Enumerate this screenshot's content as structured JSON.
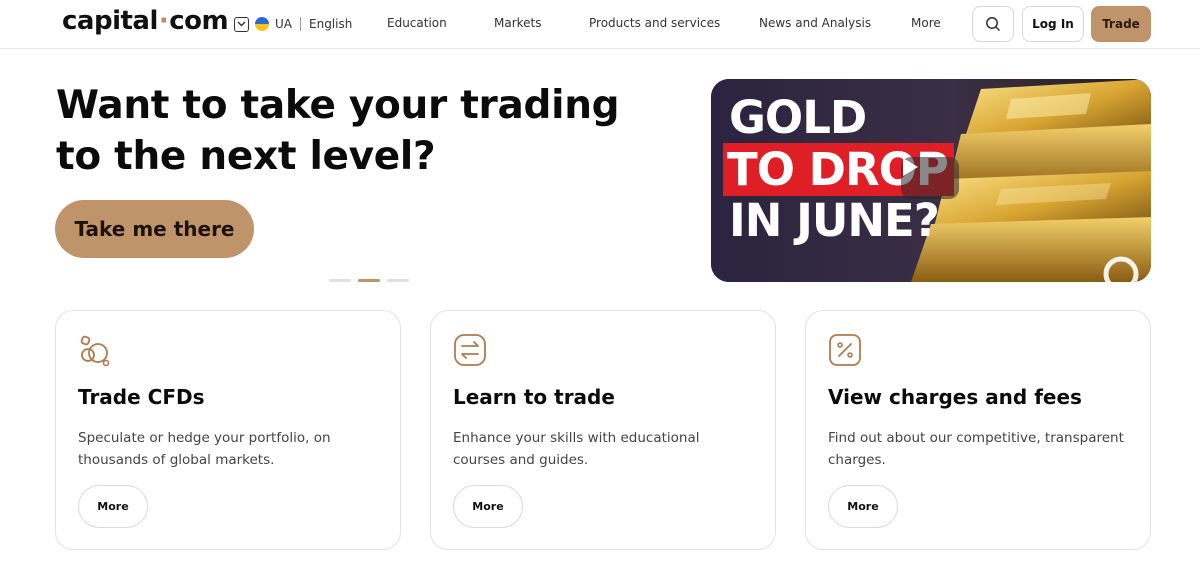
{
  "header": {
    "logo_left": "capital",
    "logo_dot": "·",
    "logo_right": "com",
    "country_code": "UA",
    "language": "English",
    "nav": [
      "Education",
      "Markets",
      "Products and services",
      "News and Analysis",
      "More"
    ],
    "search_icon": "search-icon",
    "login_label": "Log In",
    "trade_label": "Trade"
  },
  "hero": {
    "title": "Want to take your trading to the next level?",
    "cta_label": "Take me there",
    "carousel_active_index": 2,
    "carousel_count": 3,
    "video": {
      "line1": "GOLD",
      "line2": "TO DROP",
      "line3": "IN JUNE?",
      "play_icon": "play-icon"
    }
  },
  "cards": [
    {
      "icon": "coins-icon",
      "title": "Trade CFDs",
      "description": "Speculate or hedge your portfolio, on thousands of global markets.",
      "more_label": "More"
    },
    {
      "icon": "exchange-arrows-icon",
      "title": "Learn to trade",
      "description": "Enhance your skills with educational courses and guides.",
      "more_label": "More"
    },
    {
      "icon": "percent-icon",
      "title": "View charges and fees",
      "description": "Find out about our competitive, transparent charges.",
      "more_label": "More"
    }
  ],
  "colors": {
    "accent": "#c0946a",
    "video_red": "#e01e26",
    "gold": "#d9a532"
  }
}
